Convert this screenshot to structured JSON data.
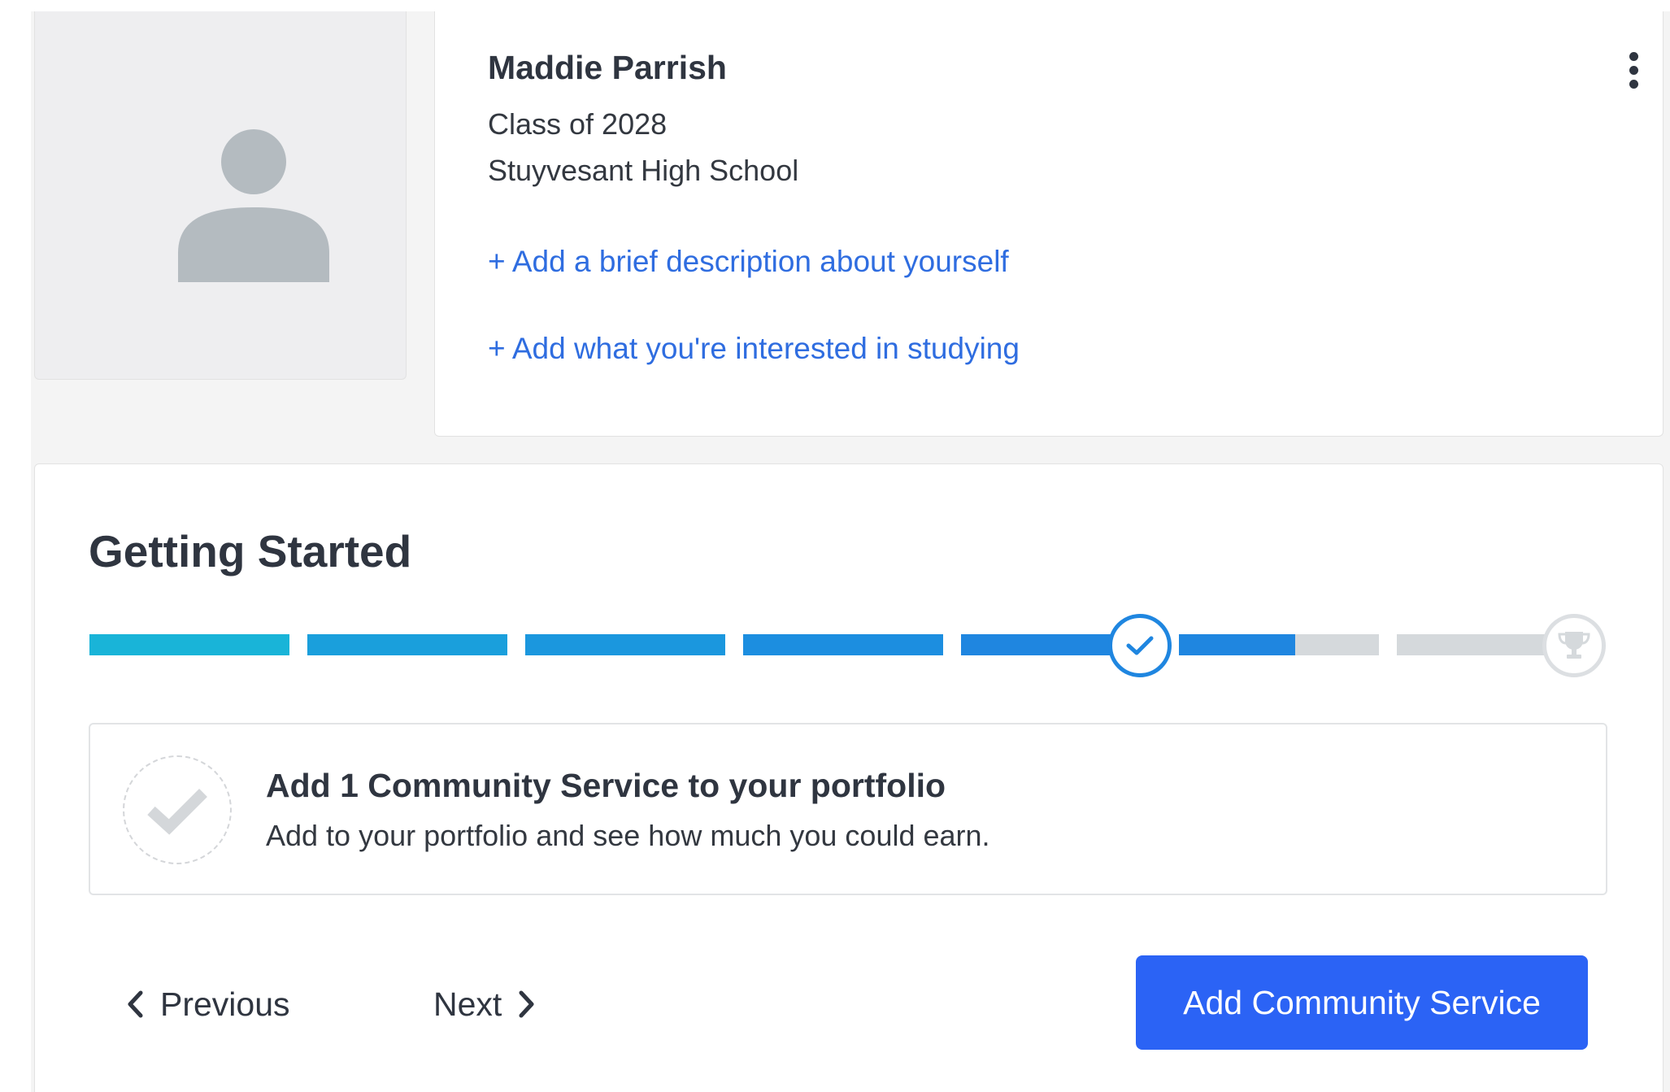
{
  "profile": {
    "name": "Maddie Parrish",
    "class_year": "Class of 2028",
    "school": "Stuyvesant High School",
    "add_description_link": "+ Add a brief description about yourself",
    "add_interests_link": "+ Add what you're interested in studying",
    "menu_icon": "more-vertical-icon",
    "avatar_icon": "user-placeholder-icon"
  },
  "getting_started": {
    "title": "Getting Started",
    "progress": {
      "total_steps": 7,
      "completed_steps": 5,
      "current_step": 6,
      "current_step_icon": "check-icon",
      "final_step_icon": "trophy-icon"
    },
    "task": {
      "title": "Add 1 Community Service to your portfolio",
      "subtitle": "Add to your portfolio and see how much you could earn.",
      "status_icon": "check-icon"
    },
    "previous_label": "Previous",
    "next_label": "Next",
    "action_label": "Add Community Service"
  },
  "colors": {
    "accent": "#2b63f5",
    "link": "#2f6de0",
    "progress_gradient": [
      "#19b4d8",
      "#1a9fdc",
      "#1b97de",
      "#1c8ee0",
      "#1f86e0"
    ],
    "progress_inactive": "#d5d9dc",
    "text_primary": "#2f3540"
  }
}
